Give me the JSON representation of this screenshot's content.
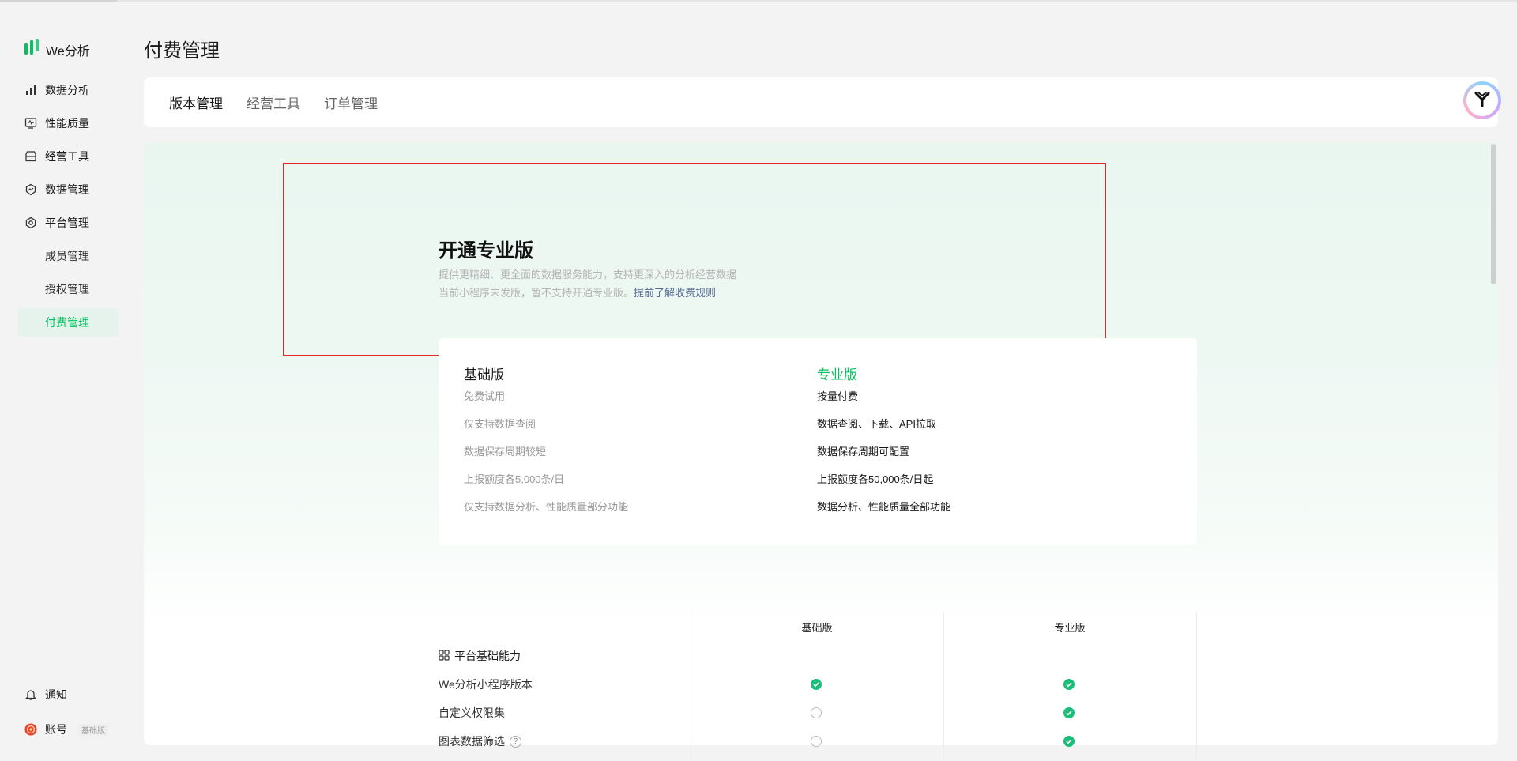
{
  "app": {
    "name": "We分析",
    "brand_color": "#07c160"
  },
  "sidebar": {
    "items": [
      {
        "label": "数据分析",
        "icon": "bar-chart-icon"
      },
      {
        "label": "性能质量",
        "icon": "monitor-pulse-icon"
      },
      {
        "label": "经营工具",
        "icon": "store-icon"
      },
      {
        "label": "数据管理",
        "icon": "data-shield-icon"
      },
      {
        "label": "平台管理",
        "icon": "hexagon-gear-icon"
      },
      {
        "label": "成员管理"
      },
      {
        "label": "授权管理"
      },
      {
        "label": "付费管理",
        "active": true
      }
    ],
    "bottom": {
      "notify_label": "通知",
      "account_label": "账号",
      "account_badge": "基础版"
    }
  },
  "page": {
    "title": "付费管理",
    "tabs": [
      {
        "label": "版本管理",
        "active": true
      },
      {
        "label": "经营工具"
      },
      {
        "label": "订单管理"
      }
    ]
  },
  "hero": {
    "title": "开通专业版",
    "desc": "提供更精细、更全面的数据服务能力，支持更深入的分析经营数据",
    "note": "当前小程序未发版，暂不支持开通专业版。",
    "link": "提前了解收费规则"
  },
  "compare": {
    "basic": {
      "title": "基础版",
      "rows": [
        "免费试用",
        "仅支持数据查阅",
        "数据保存周期较短",
        "上报额度各5,000条/日",
        "仅支持数据分析、性能质量部分功能"
      ]
    },
    "pro": {
      "title": "专业版",
      "rows": [
        "按量付费",
        "数据查阅、下载、API拉取",
        "数据保存周期可配置",
        "上报额度各50,000条/日起",
        "数据分析、性能质量全部功能"
      ]
    }
  },
  "features": {
    "headers": [
      "基础版",
      "专业版"
    ],
    "group_title": "平台基础能力",
    "rows": [
      {
        "label": "We分析小程序版本",
        "basic": true,
        "pro": true
      },
      {
        "label": "自定义权限集",
        "basic": false,
        "pro": true
      },
      {
        "label": "图表数据筛选",
        "basic": false,
        "pro": true,
        "help": "?"
      }
    ]
  }
}
